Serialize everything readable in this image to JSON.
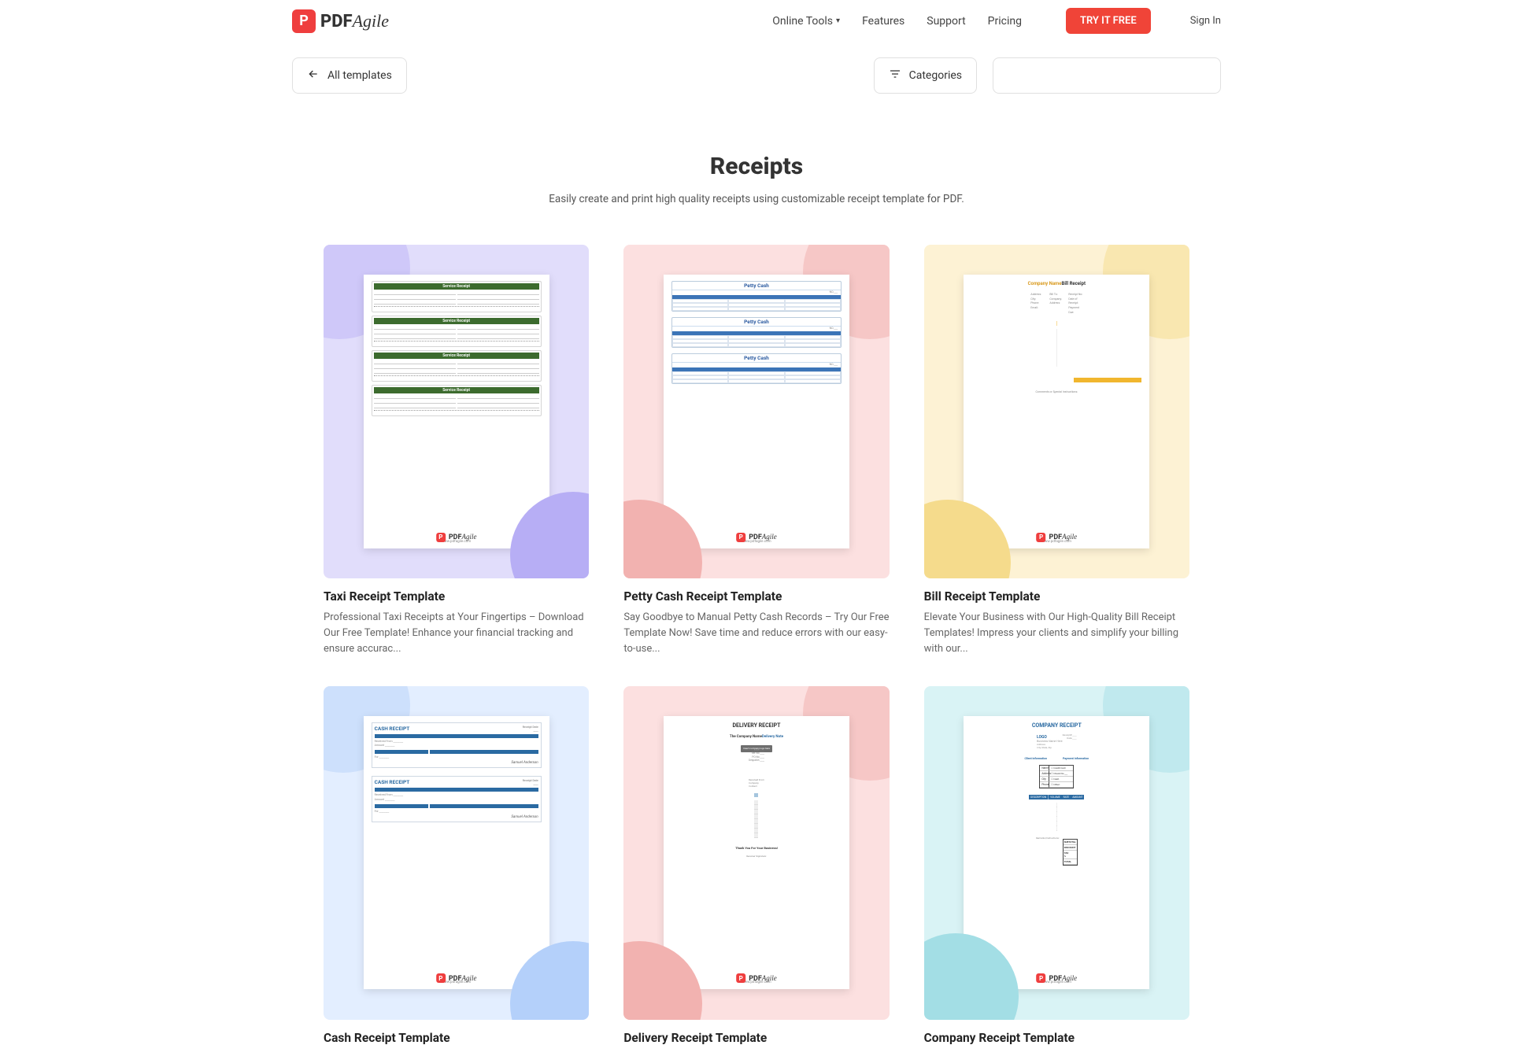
{
  "header": {
    "logo_prefix": "PDF",
    "logo_suffix": "Agile",
    "nav": {
      "online_tools": "Online Tools",
      "features": "Features",
      "support": "Support",
      "pricing": "Pricing"
    },
    "cta": "TRY IT FREE",
    "signin": "Sign In"
  },
  "toolbar": {
    "all_templates": "All templates",
    "categories": "Categories",
    "search_placeholder": ""
  },
  "page": {
    "title": "Receipts",
    "subtitle": "Easily create and print high quality receipts using customizable receipt template for PDF."
  },
  "footer_brand_prefix": "PDF",
  "footer_brand_suffix": "Agile",
  "preview_text": {
    "service_receipt": "Service Receipt",
    "petty_cash": "Petty Cash",
    "company_name": "Company Name",
    "bill_receipt": "Bill Receipt",
    "cash_receipt": "CASH RECEIPT",
    "delivery_receipt": "DELIVERY RECEIPT",
    "the_company_name": "The Company Name",
    "delivery_note": "Delivery Note",
    "thank_you": "Thank You For Your Business!",
    "company_receipt": "COMPANY RECEIPT",
    "logo": "LOGO",
    "business_name_here": "Business Name Here",
    "client_information": "Client Information",
    "payment_information": "Payment Information",
    "description": "DESCRIPTION",
    "volume": "VOLUME",
    "rate": "RATE",
    "amount": "AMOUNT",
    "pdfagile_url": "www.pdfagile.com"
  },
  "cards": [
    {
      "title": "Taxi Receipt Template",
      "desc": "Professional Taxi Receipts at Your Fingertips – Download Our Free Template! Enhance your financial tracking and ensure accurac...",
      "bg": "bg-purple",
      "preview": "taxi"
    },
    {
      "title": "Petty Cash Receipt Template",
      "desc": "Say Goodbye to Manual Petty Cash Records – Try Our Free Template Now! Save time and reduce errors with our easy-to-use...",
      "bg": "bg-pink",
      "preview": "petty"
    },
    {
      "title": "Bill Receipt Template",
      "desc": "Elevate Your Business with Our High-Quality Bill Receipt Templates! Impress your clients and simplify your billing with our...",
      "bg": "bg-yellow",
      "preview": "bill"
    },
    {
      "title": "Cash Receipt Template",
      "desc": "",
      "bg": "bg-blue",
      "preview": "cash"
    },
    {
      "title": "Delivery Receipt Template",
      "desc": "",
      "bg": "bg-pink",
      "preview": "delivery"
    },
    {
      "title": "Company Receipt Template",
      "desc": "",
      "bg": "bg-teal",
      "preview": "company"
    }
  ]
}
